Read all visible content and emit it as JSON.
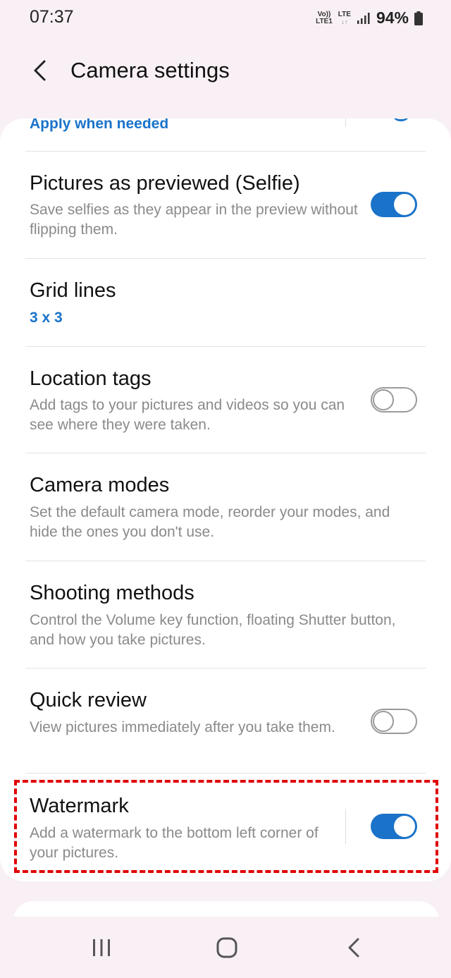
{
  "status_bar": {
    "time": "07:37",
    "volte_top": "Vo))",
    "volte_bottom": "LTE1",
    "lte_label": "LTE",
    "battery": "94%"
  },
  "header": {
    "title": "Camera settings"
  },
  "settings": {
    "partial": {
      "value": "Apply when needed"
    },
    "items": [
      {
        "title": "Pictures as previewed (Selfie)",
        "subtitle": "Save selfies as they appear in the preview without flipping them.",
        "toggle": true
      },
      {
        "title": "Grid lines",
        "value": "3 x 3"
      },
      {
        "title": "Location tags",
        "subtitle": "Add tags to your pictures and videos so you can see where they were taken.",
        "toggle": false
      },
      {
        "title": "Camera modes",
        "subtitle": "Set the default camera mode, reorder your modes, and hide the ones you don't use."
      },
      {
        "title": "Shooting methods",
        "subtitle": "Control the Volume key function, floating Shutter button, and how you take pictures."
      },
      {
        "title": "Quick review",
        "subtitle": "View pictures immediately after you take them.",
        "toggle": false
      },
      {
        "title": "Watermark",
        "subtitle": "Add a watermark to the bottom left corner of your pictures.",
        "toggle": true
      }
    ]
  },
  "colors": {
    "accent": "#1a73c9",
    "highlight": "#e00000",
    "background": "#f8f0f4"
  },
  "icons": {
    "back": "chevron-left-icon",
    "nav_recents": "recents-icon",
    "nav_home": "home-icon",
    "nav_back": "back-icon"
  }
}
